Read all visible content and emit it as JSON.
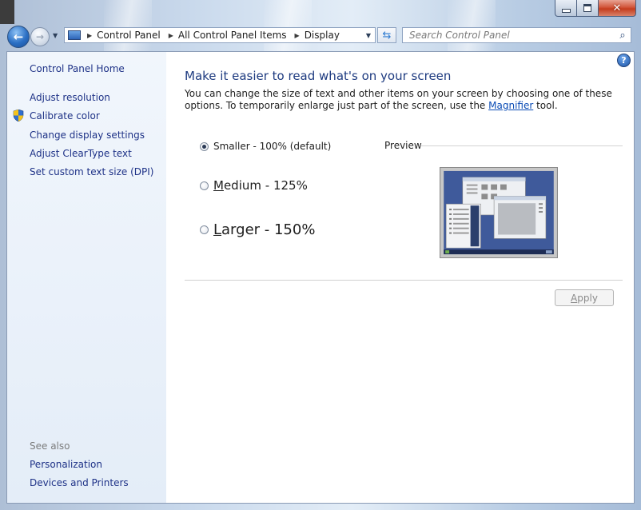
{
  "window": {
    "min_glyph": "",
    "close_glyph": "✕"
  },
  "nav": {
    "back_glyph": "←",
    "forward_glyph": "→",
    "breadcrumbs": [
      "Control Panel",
      "All Control Panel Items",
      "Display"
    ],
    "search_placeholder": "Search Control Panel"
  },
  "sidebar": {
    "home": "Control Panel Home",
    "links": [
      "Adjust resolution",
      "Calibrate color",
      "Change display settings",
      "Adjust ClearType text",
      "Set custom text size (DPI)"
    ],
    "see_also_label": "See also",
    "see_also": [
      "Personalization",
      "Devices and Printers"
    ]
  },
  "main": {
    "title": "Make it easier to read what's on your screen",
    "desc_before": "You can change the size of text and other items on your screen by choosing one of these options. To temporarily enlarge just part of the screen, use the ",
    "desc_link": "Magnifier",
    "desc_after": " tool.",
    "options": {
      "smaller": "Smaller - 100% (default)",
      "medium_key": "M",
      "medium_rest": "edium - 125%",
      "larger_key": "L",
      "larger_rest": "arger - 150%"
    },
    "selected_option": "smaller",
    "preview_label": "Preview",
    "apply_key": "A",
    "apply_rest": "pply"
  },
  "colors": {
    "link": "#1e3287",
    "title": "#1e3b80",
    "preview_desktop": "#3f5a9b"
  }
}
